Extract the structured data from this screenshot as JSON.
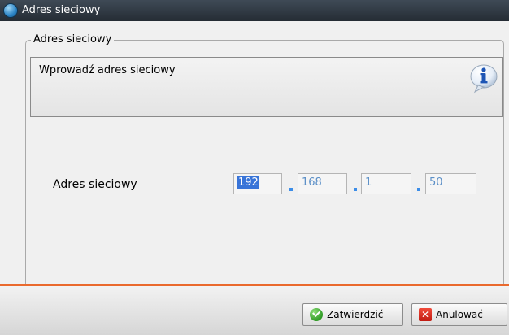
{
  "window": {
    "title": "Adres sieciowy"
  },
  "group": {
    "legend": "Adres sieciowy"
  },
  "info": {
    "message": "Wprowadź adres sieciowy",
    "icon": "info-icon"
  },
  "field": {
    "label": "Adres sieciowy",
    "octets": [
      "192",
      "168",
      "1",
      "50"
    ],
    "separator": "."
  },
  "buttons": {
    "confirm": {
      "label": "Zatwierdzić",
      "icon": "check-icon"
    },
    "cancel": {
      "label": "Anulować",
      "icon": "cancel-icon"
    }
  },
  "colors": {
    "accent_line": "#ea6a2e",
    "octet_text": "#5b8fc7",
    "selection": "#3874d8"
  }
}
